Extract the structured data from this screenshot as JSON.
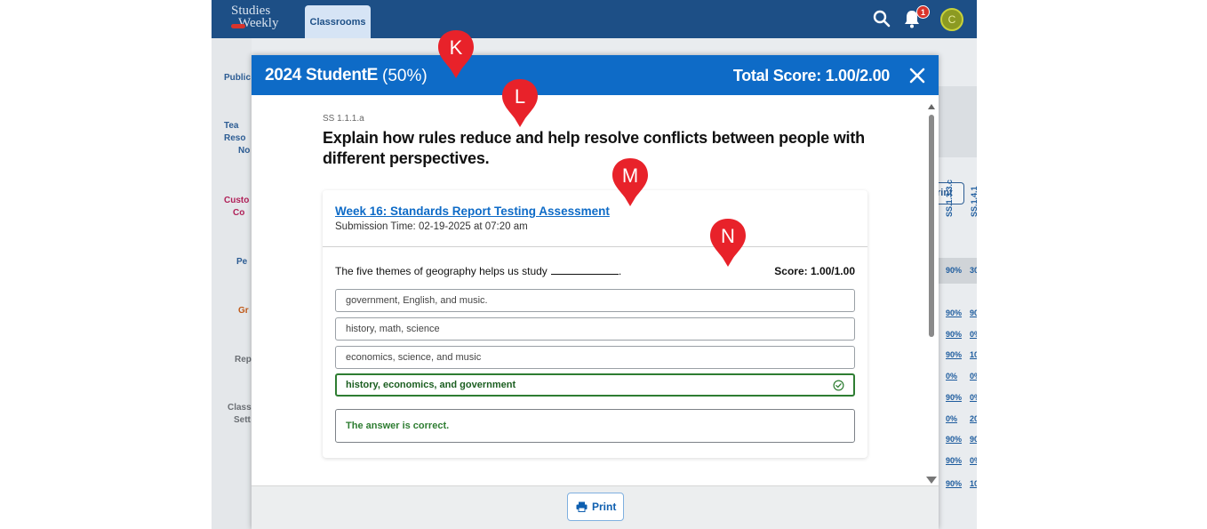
{
  "app": {
    "logo_line1": "Studies",
    "logo_line2": "Weekly",
    "active_tab": "Classrooms",
    "notification_count": "1",
    "avatar_initial": "C"
  },
  "sidebar_fragments": {
    "publications": "Public",
    "teacher_resources_1": "Tea",
    "teacher_resources_2": "Reso",
    "teacher_resources_3": "No",
    "custom_1": "Custo",
    "custom_2": "Co",
    "people": "Pe",
    "grades": "Gr",
    "reports": "Rep",
    "class_settings_1": "Class",
    "class_settings_2": "Sett"
  },
  "background_table": {
    "print_label": "rint",
    "col_header_1": "SS.1.3.3.c",
    "col_header_2": "SS.1.4.1",
    "rows": [
      {
        "a": "90%",
        "b": "30"
      },
      {
        "a": "90%",
        "b": "90"
      },
      {
        "a": "90%",
        "b": "0%"
      },
      {
        "a": "90%",
        "b": "10"
      },
      {
        "a": "0%",
        "b": "0%"
      },
      {
        "a": "90%",
        "b": "0%"
      },
      {
        "a": "0%",
        "b": "20"
      },
      {
        "a": "90%",
        "b": "90"
      },
      {
        "a": "90%",
        "b": "0%"
      },
      {
        "a": "90%",
        "b": "10"
      }
    ]
  },
  "modal": {
    "student_name": "2024 StudentE",
    "student_percent": "(50%)",
    "total_score": "Total Score: 1.00/2.00",
    "standard_code": "SS 1.1.1.a",
    "standard_description": "Explain how rules reduce and help resolve conflicts between people with different perspectives.",
    "assessment_title": "Week 16: Standards Report Testing Assessment",
    "submission_time": "Submission Time: 02-19-2025 at 07:20 am",
    "question_text": "The five themes of geography helps us study",
    "question_end": ".",
    "score": "Score: 1.00/1.00",
    "choices": [
      {
        "label": "government, English, and music.",
        "correct": false
      },
      {
        "label": "history, math, science",
        "correct": false
      },
      {
        "label": "economics, science, and music",
        "correct": false
      },
      {
        "label": "history, economics, and government",
        "correct": true
      }
    ],
    "feedback": "The answer is correct.",
    "print_label": "Print"
  },
  "markers": [
    "K",
    "L",
    "M",
    "N"
  ],
  "colors": {
    "header_blue": "#0e6bc7",
    "appbar_blue": "#1d4f86",
    "correct_green": "#2e7d32",
    "marker_red": "#e8222a"
  }
}
